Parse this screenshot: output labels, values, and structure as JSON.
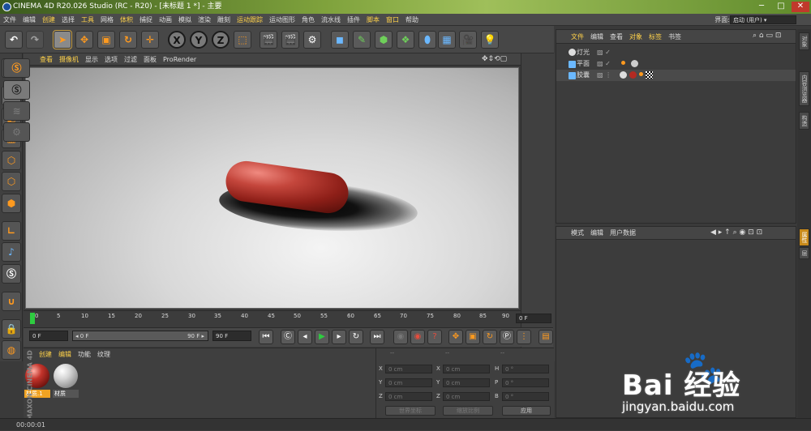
{
  "window": {
    "title": "CINEMA 4D R20.026 Studio (RC - R20) - [未标题 1 *] - 主要",
    "minimize": "─",
    "maximize": "□",
    "close": "✕"
  },
  "menubar": [
    "文件",
    "编辑",
    "创建",
    "选择",
    "工具",
    "网格",
    "体积",
    "捕捉",
    "动画",
    "模拟",
    "渲染",
    "雕刻",
    "运动跟踪",
    "运动图形",
    "角色",
    "流水线",
    "插件",
    "脚本",
    "窗口",
    "帮助"
  ],
  "layout": {
    "label": "界面:",
    "value": "启动 (用户)"
  },
  "toolbar": {
    "undo": "↶",
    "redo": "↷",
    "axes": [
      "X",
      "Y",
      "Z"
    ]
  },
  "viewport": {
    "menu": [
      "查看",
      "摄像机",
      "显示",
      "选项",
      "过滤",
      "面板",
      "ProRender"
    ]
  },
  "timeline": {
    "ticks": [
      "0",
      "5",
      "10",
      "15",
      "20",
      "25",
      "30",
      "35",
      "40",
      "45",
      "50",
      "55",
      "60",
      "65",
      "70",
      "75",
      "80",
      "85",
      "90"
    ],
    "current_frame": "0 F"
  },
  "transport": {
    "start": "0 F",
    "range_start": "◂ 0 F",
    "range_end": "90 F ▸",
    "end": "90 F"
  },
  "materials": {
    "menu": [
      "创建",
      "编辑",
      "功能",
      "纹理"
    ],
    "items": [
      {
        "name": "材质.1",
        "selected": true,
        "color": "#b32a22"
      },
      {
        "name": "材质",
        "selected": false,
        "color": "#cfcfcf"
      }
    ]
  },
  "coords": {
    "headers": [
      "--",
      "--",
      "--"
    ],
    "rows": [
      [
        "X",
        "0 cm",
        "X",
        "0 cm",
        "H",
        "0 °"
      ],
      [
        "Y",
        "0 cm",
        "Y",
        "0 cm",
        "P",
        "0 °"
      ],
      [
        "Z",
        "0 cm",
        "Z",
        "0 cm",
        "B",
        "0 °"
      ]
    ],
    "world": "世界坐标",
    "scale": "缩放比例",
    "apply": "应用"
  },
  "objects": {
    "menu": [
      "文件",
      "编辑",
      "查看",
      "对象",
      "标签",
      "书签"
    ],
    "rows": [
      {
        "name": "灯光"
      },
      {
        "name": "平面"
      },
      {
        "name": "胶囊"
      }
    ]
  },
  "attributes": {
    "menu": [
      "模式",
      "编辑",
      "用户数据"
    ]
  },
  "side_tabs": [
    "对象",
    "内容浏览器",
    "构造",
    "属性",
    "层"
  ],
  "status": {
    "time": "00:00:01"
  },
  "brand": {
    "maxon": "MAXON CINEMA 4D"
  },
  "watermark": {
    "logo": "Bai 经验",
    "url": "jingyan.baidu.com"
  }
}
